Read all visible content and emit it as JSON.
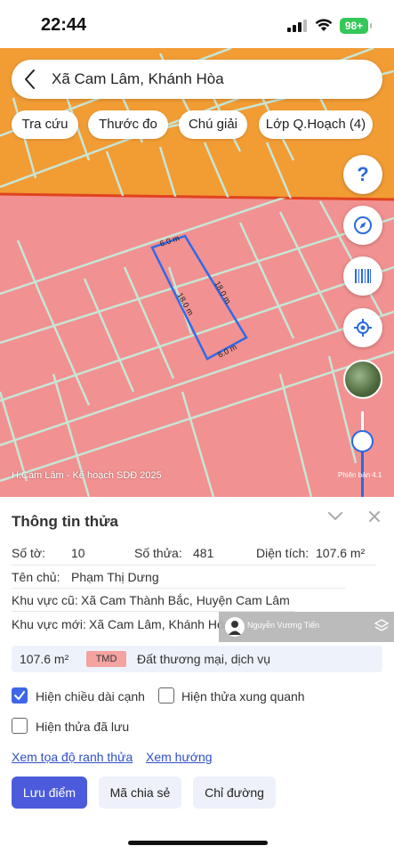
{
  "status_bar": {
    "time": "22:44",
    "battery": "98+"
  },
  "header": {
    "title": "Xã Cam Lâm, Khánh Hòa"
  },
  "chips": [
    "Tra cứu",
    "Thước đo",
    "Chú giải",
    "Lớp Q.Hoạch (4)"
  ],
  "map": {
    "caption": "H.Cam Lâm - Kế hoạch SDĐ 2025",
    "version": "Phiên bản 4.1",
    "edge_labels": {
      "top": "6.0 m",
      "bottom": "6.0 m",
      "left": "18.0 m",
      "right": "18.0 m"
    },
    "colors": {
      "zone_commercial": "#f29c34",
      "zone_residential": "#f29191",
      "parcel_outline": "#2f6ae6",
      "parcel_lines": "#c7e6d6"
    },
    "zoom_level": 0.33
  },
  "panel": {
    "title": "Thông tin thửa",
    "so_to_label": "Số tờ:",
    "so_to_value": "10",
    "so_thua_label": "Số thửa:",
    "so_thua_value": "481",
    "dien_tich_label": "Diện tích:",
    "dien_tich_value": "107.6 m²",
    "ten_chu_label": "Tên chủ:",
    "ten_chu_value": "Phạm Thị Dưng",
    "khu_vuc_cu_label": "Khu vực cũ:",
    "khu_vuc_cu_value": "Xã Cam Thành Bắc, Huyện Cam Lâm",
    "khu_vuc_moi_label": "Khu vực mới:",
    "khu_vuc_moi_value": "Xã Cam Lâm, Khánh Hòa",
    "watermark": "Nguyễn Vương Tiến",
    "land_use": {
      "area": "107.6 m²",
      "code": "TMD",
      "description": "Đất thương mại, dịch vụ"
    },
    "checkboxes": [
      {
        "label": "Hiện chiều dài cạnh",
        "checked": true
      },
      {
        "label": "Hiện thửa xung quanh",
        "checked": false
      },
      {
        "label": "Hiện thửa đã lưu",
        "checked": false
      }
    ],
    "links": [
      "Xem tọa độ ranh thửa",
      "Xem hướng"
    ],
    "buttons": [
      "Lưu điểm",
      "Mã chia sẻ",
      "Chỉ đường"
    ]
  }
}
